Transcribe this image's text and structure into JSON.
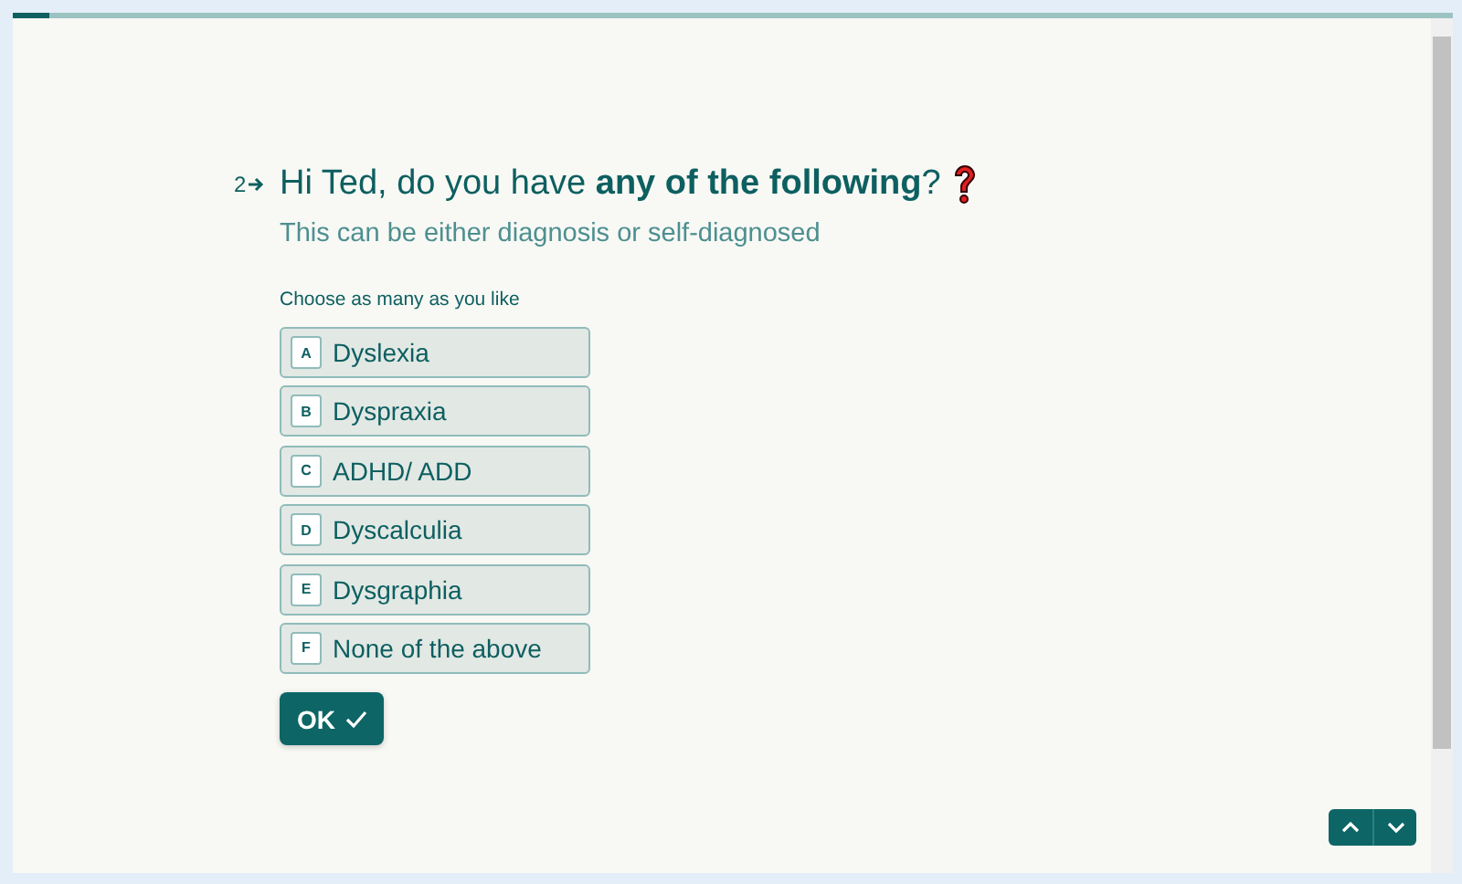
{
  "progress": {
    "level": 0.025
  },
  "question": {
    "number": "2",
    "title": "Hi Ted, do you have **any of the following**?",
    "subtitle": "This can be either diagnosis or self-diagnosed",
    "hint": "Choose as many as you like"
  },
  "options": [
    {
      "key": "A",
      "label": "Dyslexia",
      "selected": false
    },
    {
      "key": "B",
      "label": "Dyspraxia",
      "selected": false
    },
    {
      "key": "C",
      "label": "ADHD/ ADD",
      "selected": false
    },
    {
      "key": "D",
      "label": "Dyscalculia",
      "selected": false
    },
    {
      "key": "E",
      "label": "Dysgraphia",
      "selected": false
    },
    {
      "key": "F",
      "label": "None of the above",
      "selected": false
    }
  ],
  "ok_button": "OK"
}
